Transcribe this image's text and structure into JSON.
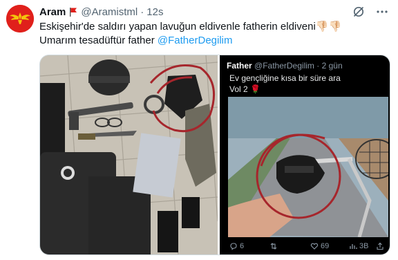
{
  "tweet": {
    "author_name": "Aram",
    "handle": "@Aramistml",
    "separator": "·",
    "timestamp": "12s",
    "text_line1": "Eskişehir'de saldırı yapan lavuğun eldivenle fatherin eldiveni👎🏻👎🏻",
    "text_line2_prefix": "Umarım tesadüftür father ",
    "mention": "@FatherDegilim"
  },
  "icons": {
    "grok": "grok-icon",
    "more": "more-options-icon",
    "flag": "red-flag-icon"
  },
  "embedded_tweet": {
    "author_name": "Father",
    "handle": "@FatherDegilim",
    "separator": "·",
    "timestamp": "2 gün",
    "text_line1": "Ev gençliğine kısa bir süre ara",
    "text_line2": "Vol 2",
    "emoji": "🌹",
    "actions": {
      "reply": "6",
      "retweet": "",
      "like": "69",
      "views": "3B"
    }
  },
  "colors": {
    "accent": "#1d9bf0",
    "text": "#0f1419",
    "muted": "#536471",
    "avatar_bg": "#e0201b"
  }
}
